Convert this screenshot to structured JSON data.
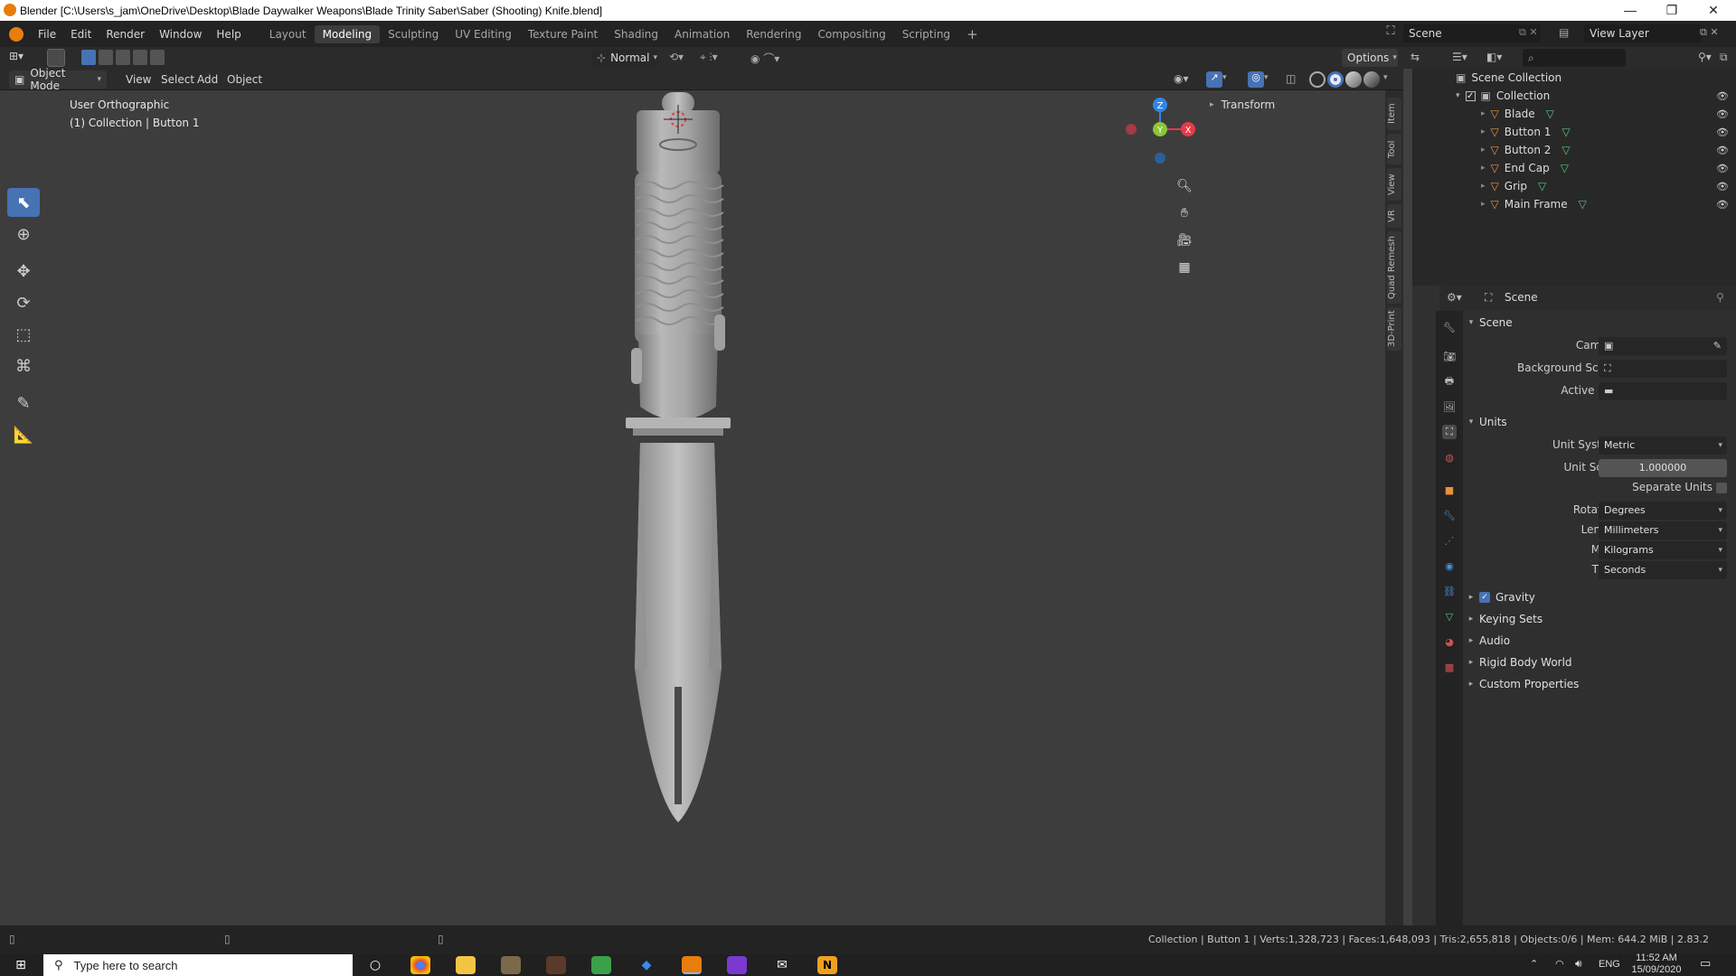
{
  "window": {
    "title": "Blender [C:\\Users\\s_jam\\OneDrive\\Desktop\\Blade Daywalker Weapons\\Blade Trinity Saber\\Saber (Shooting) Knife.blend]",
    "controls": [
      "—",
      "❐",
      "✕"
    ]
  },
  "menubar": {
    "menus": [
      "File",
      "Edit",
      "Render",
      "Window",
      "Help"
    ],
    "workspaces": [
      "Layout",
      "Modeling",
      "Sculpting",
      "UV Editing",
      "Texture Paint",
      "Shading",
      "Animation",
      "Rendering",
      "Compositing",
      "Scripting"
    ],
    "active_workspace": "Modeling",
    "add_tab": "+",
    "scene": "Scene",
    "view_layer": "View Layer"
  },
  "viewport_toolbar": {
    "orientation": "Normal",
    "options": "Options"
  },
  "viewport_header": {
    "mode": "Object Mode",
    "menus": [
      "View",
      "Select",
      "Add",
      "Object"
    ]
  },
  "viewport": {
    "view_name": "User Orthographic",
    "context": "(1) Collection | Button 1",
    "transform_panel": "Transform",
    "axes": {
      "z": "Z",
      "y": "Y",
      "x": "X"
    },
    "colors": {
      "x": "#e8394a",
      "y": "#8cc736",
      "z": "#2f86e6",
      "background": "#3d3d3d"
    }
  },
  "sidebar_tabs": [
    "Item",
    "Tool",
    "View",
    "VR",
    "Quad Remesh",
    "3D-Print"
  ],
  "outliner": {
    "root": "Scene Collection",
    "collection": "Collection",
    "objects": [
      "Blade",
      "Button 1",
      "Button 2",
      "End Cap",
      "Grip",
      "Main Frame"
    ]
  },
  "properties": {
    "header": "Scene",
    "scene_section": "Scene",
    "camera_label": "Camera",
    "background_scene_label": "Background Scene",
    "active_clip_label": "Active Clip",
    "units_section": "Units",
    "unit_system_label": "Unit System",
    "unit_system": "Metric",
    "unit_scale_label": "Unit Scale",
    "unit_scale": "1.000000",
    "separate_units_label": "Separate Units",
    "rotation_label": "Rotation",
    "rotation": "Degrees",
    "length_label": "Length",
    "length": "Millimeters",
    "mass_label": "Mass",
    "mass": "Kilograms",
    "time_label": "Time",
    "time": "Seconds",
    "gravity": "Gravity",
    "keying_sets": "Keying Sets",
    "audio": "Audio",
    "rigid_body_world": "Rigid Body World",
    "custom_properties": "Custom Properties"
  },
  "statusbar": {
    "stats": "Collection | Button 1 | Verts:1,328,723 | Faces:1,648,093 | Tris:2,655,818 | Objects:0/6 | Mem: 644.2 MiB | 2.83.2"
  },
  "taskbar": {
    "search_placeholder": "Type here to search",
    "language": "ENG",
    "time": "11:52 AM",
    "date": "15/09/2020"
  }
}
